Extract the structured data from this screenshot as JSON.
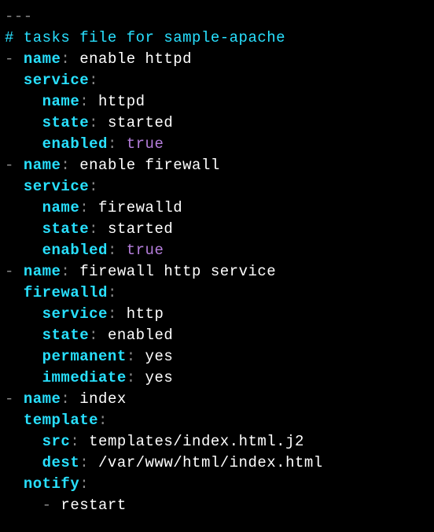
{
  "doc_start": "---",
  "comment": "# tasks file for sample-apache",
  "k": {
    "name": "name",
    "service": "service",
    "state": "state",
    "enabled": "enabled",
    "firewalld": "firewalld",
    "service_key": "service",
    "permanent": "permanent",
    "immediate": "immediate",
    "template": "template",
    "src": "src",
    "dest": "dest",
    "notify": "notify"
  },
  "v": {
    "t1_name": "enable httpd",
    "t1_svc": "httpd",
    "t1_state": "started",
    "t1_enabled": "true",
    "t2_name": "enable firewall",
    "t2_svc": "firewalld",
    "t2_state": "started",
    "t2_enabled": "true",
    "t3_name": "firewall http service",
    "t3_svc": "http",
    "t3_state": "enabled",
    "t3_perm": "yes",
    "t3_imm": "yes",
    "t4_name": "index",
    "t4_src": "templates/index.html.j2",
    "t4_dest": "/var/www/html/index.html",
    "t4_notify": "restart"
  }
}
